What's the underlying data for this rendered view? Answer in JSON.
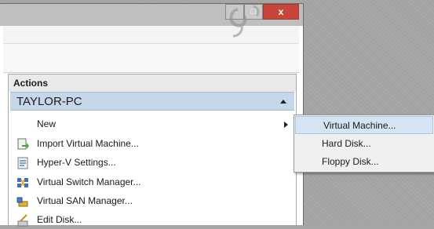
{
  "window": {
    "controls": {
      "minimize": "–",
      "maximize": "□",
      "close": "x"
    }
  },
  "actions": {
    "header": "Actions",
    "group": "TAYLOR-PC",
    "items": [
      {
        "label": "New",
        "icon": "none",
        "has_submenu": true
      },
      {
        "label": "Import Virtual Machine...",
        "icon": "import-vm-icon"
      },
      {
        "label": "Hyper-V Settings...",
        "icon": "settings-icon"
      },
      {
        "label": "Virtual Switch Manager...",
        "icon": "virtual-switch-icon"
      },
      {
        "label": "Virtual SAN Manager...",
        "icon": "virtual-san-icon"
      },
      {
        "label": "Edit Disk...",
        "icon": "edit-disk-icon"
      }
    ]
  },
  "submenu": {
    "items": [
      {
        "label": "Virtual Machine...",
        "selected": true
      },
      {
        "label": "Hard Disk..."
      },
      {
        "label": "Floppy Disk..."
      }
    ]
  },
  "colors": {
    "close_button": "#c7463b",
    "group_header": "#c6d7e9",
    "flyout_selection": "#d5e3f2",
    "desktop": "#a6a5a3"
  }
}
